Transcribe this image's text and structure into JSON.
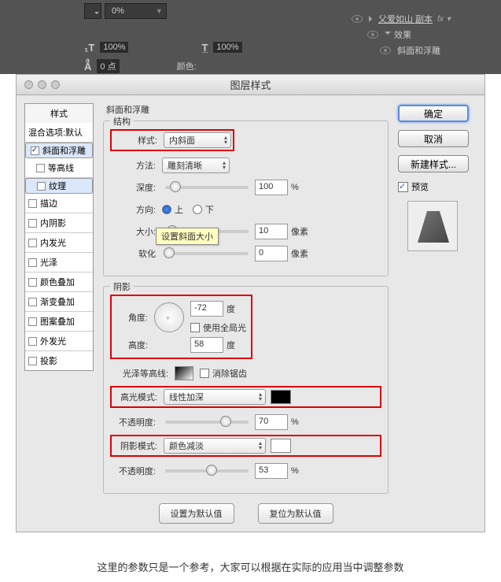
{
  "topbar": {
    "zoom_percent": "0%",
    "text_size1": "100%",
    "text_size2": "100%",
    "leading_val": "0 点",
    "color_label": "颜色:",
    "layer_name": "父爱如山 副本",
    "fx": "fx",
    "effects": "效果",
    "bevel": "斜面和浮雕"
  },
  "dialog_title": "图层样式",
  "left": {
    "style_tab": "样式",
    "blend_default": "混合选项:默认",
    "items": [
      {
        "label": "斜面和浮雕",
        "checked": true,
        "sub": false,
        "sel": true
      },
      {
        "label": "等高线",
        "checked": false,
        "sub": true,
        "sel": false
      },
      {
        "label": "纹理",
        "checked": false,
        "sub": true,
        "sel": true
      },
      {
        "label": "描边",
        "checked": false,
        "sub": false,
        "sel": false
      },
      {
        "label": "内阴影",
        "checked": false,
        "sub": false,
        "sel": false
      },
      {
        "label": "内发光",
        "checked": false,
        "sub": false,
        "sel": false
      },
      {
        "label": "光泽",
        "checked": false,
        "sub": false,
        "sel": false
      },
      {
        "label": "颜色叠加",
        "checked": false,
        "sub": false,
        "sel": false
      },
      {
        "label": "渐变叠加",
        "checked": false,
        "sub": false,
        "sel": false
      },
      {
        "label": "图案叠加",
        "checked": false,
        "sub": false,
        "sel": false
      },
      {
        "label": "外发光",
        "checked": false,
        "sub": false,
        "sel": false
      },
      {
        "label": "投影",
        "checked": false,
        "sub": false,
        "sel": false
      }
    ]
  },
  "center": {
    "group_title": "斜面和浮雕",
    "struct_title": "结构",
    "style_label": "样式:",
    "style_value": "内斜面",
    "method_label": "方法:",
    "method_value": "雕刻清晰",
    "depth_label": "深度:",
    "depth_value": "100",
    "percent": "%",
    "dir_label": "方向:",
    "dir_up": "上",
    "dir_down": "下",
    "size_label": "大小:",
    "size_value": "10",
    "px": "像素",
    "soften_label": "软化",
    "soften_value": "0",
    "tooltip": "设置斜面大小",
    "shade_title": "阴影",
    "angle_label": "角度:",
    "angle_value": "-72",
    "deg": "度",
    "global_light": "使用全局光",
    "alt_label": "高度:",
    "alt_value": "58",
    "gloss_label": "光泽等高线:",
    "antialias": "消除锯齿",
    "hi_mode_label": "高光模式:",
    "hi_mode_value": "线性加深",
    "opacity_label": "不透明度:",
    "hi_op_value": "70",
    "sh_mode_label": "阴影模式:",
    "sh_mode_value": "颜色减淡",
    "sh_op_value": "53",
    "set_default": "设置为默认值",
    "reset_default": "复位为默认值",
    "hi_color": "#000000",
    "sh_color": "#ffffff"
  },
  "right": {
    "ok": "确定",
    "cancel": "取消",
    "new_style": "新建样式...",
    "preview": "预览"
  },
  "caption": "这里的参数只是一个参考，大家可以根据在实际的应用当中调整参数"
}
